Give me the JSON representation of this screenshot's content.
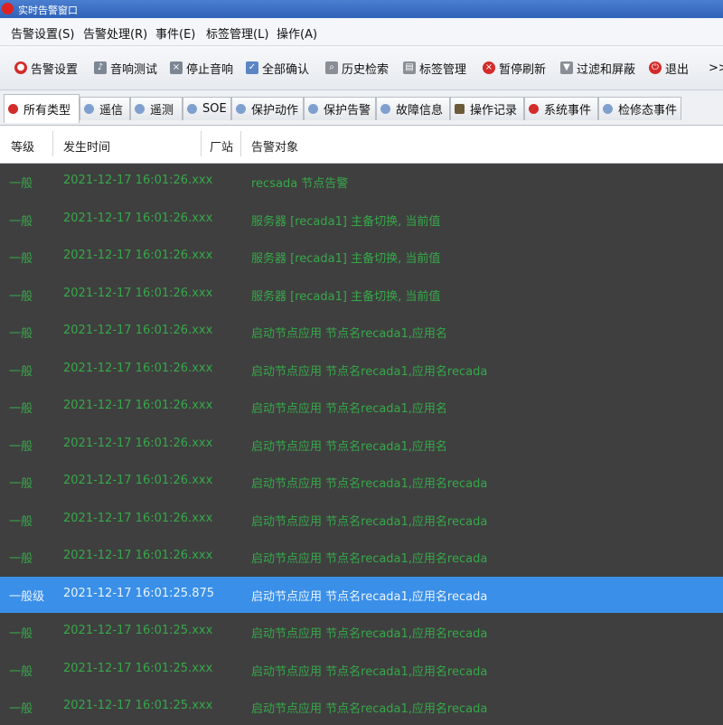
{
  "window": {
    "title": "实时告警窗口"
  },
  "menu": [
    "告警设置(S)",
    "告警处理(R)",
    "事件(E)",
    "标签管理(L)",
    "操作(A)"
  ],
  "toolbar": {
    "alarm_settings": "告警设置",
    "sound_test": "音响测试",
    "stop_sound": "停止音响",
    "confirm_all": "全部确认",
    "history_search": "历史检索",
    "tag_management": "标签管理",
    "pause_refresh": "暂停刷新",
    "filter_shield": "过滤和屏蔽",
    "exit": "退出",
    "more": ">>"
  },
  "tabs": [
    "所有类型",
    "遥信",
    "遥测",
    "SOE",
    "保护动作",
    "保护告警",
    "故障信息",
    "操作记录",
    "系统事件",
    "检修态事件"
  ],
  "columns": {
    "level": "等级",
    "time": "发生时间",
    "station": "厂站",
    "object": "告警对象"
  },
  "rows": [
    {
      "level": "一般",
      "time": "2021-12-17 16:01:26.xxx",
      "station": "",
      "object": "recsada 节点告警"
    },
    {
      "level": "一般",
      "time": "2021-12-17 16:01:26.xxx",
      "station": "",
      "object": "服务器 [recada1] 主备切换, 当前值"
    },
    {
      "level": "一般",
      "time": "2021-12-17 16:01:26.xxx",
      "station": "",
      "object": "服务器 [recada1] 主备切换, 当前值"
    },
    {
      "level": "一般",
      "time": "2021-12-17 16:01:26.xxx",
      "station": "",
      "object": "服务器 [recada1] 主备切换, 当前值"
    },
    {
      "level": "一般",
      "time": "2021-12-17 16:01:26.xxx",
      "station": "",
      "object": "启动节点应用 节点名recada1,应用名"
    },
    {
      "level": "一般",
      "time": "2021-12-17 16:01:26.xxx",
      "station": "",
      "object": "启动节点应用 节点名recada1,应用名recada"
    },
    {
      "level": "一般",
      "time": "2021-12-17 16:01:26.xxx",
      "station": "",
      "object": "启动节点应用 节点名recada1,应用名"
    },
    {
      "level": "一般",
      "time": "2021-12-17 16:01:26.xxx",
      "station": "",
      "object": "启动节点应用 节点名recada1,应用名"
    },
    {
      "level": "一般",
      "time": "2021-12-17 16:01:26.xxx",
      "station": "",
      "object": "启动节点应用 节点名recada1,应用名recada"
    },
    {
      "level": "一般",
      "time": "2021-12-17 16:01:26.xxx",
      "station": "",
      "object": "启动节点应用 节点名recada1,应用名recada"
    },
    {
      "level": "一般",
      "time": "2021-12-17 16:01:26.xxx",
      "station": "",
      "object": "启动节点应用 节点名recada1,应用名recada"
    },
    {
      "level": "一般级",
      "time": "2021-12-17 16:01:25.875",
      "station": "",
      "object": "启动节点应用 节点名recada1,应用名recada",
      "selected": true
    },
    {
      "level": "一般",
      "time": "2021-12-17 16:01:25.xxx",
      "station": "",
      "object": "启动节点应用 节点名recada1,应用名recada"
    },
    {
      "level": "一般",
      "time": "2021-12-17 16:01:25.xxx",
      "station": "",
      "object": "启动节点应用 节点名recada1,应用名recada"
    },
    {
      "level": "一般",
      "time": "2021-12-17 16:01:25.xxx",
      "station": "",
      "object": "启动节点应用 节点名recada1,应用名recada"
    }
  ],
  "colors": {
    "row_text": "#36a84a",
    "selected_bg": "#3a8fe8",
    "grid_bg": "#3f3f3f"
  }
}
